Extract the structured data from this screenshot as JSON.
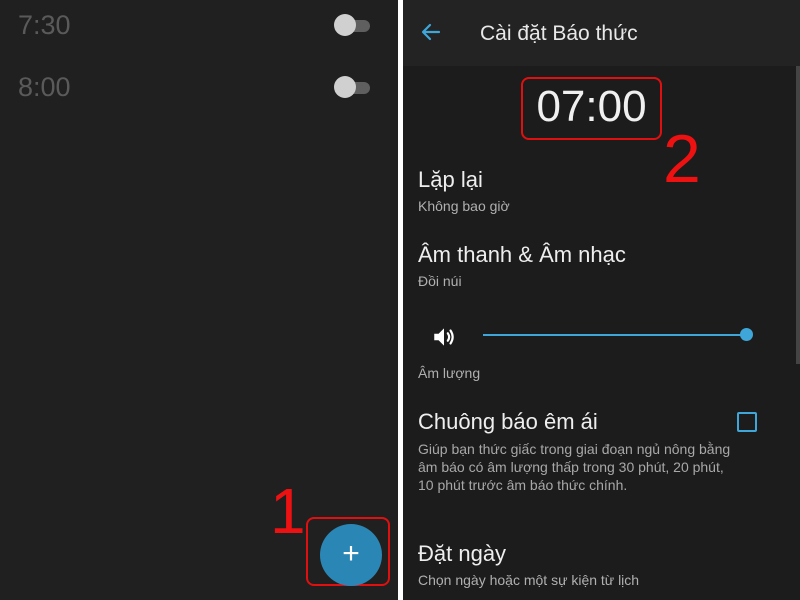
{
  "left_panel": {
    "alarms": [
      {
        "time": "7:30",
        "enabled": false
      },
      {
        "time": "8:00",
        "enabled": false
      }
    ],
    "add_button": {
      "label": "+"
    },
    "marker_label": "1"
  },
  "right_panel": {
    "header": {
      "title": "Cài đặt Báo thức",
      "back_icon": "arrow-left-icon"
    },
    "alarm_time": "07:00",
    "marker_label": "2",
    "repeat": {
      "title": "Lặp lại",
      "value": "Không bao giờ"
    },
    "sound": {
      "title": "Âm thanh & Âm nhạc",
      "value": "Đồi núi"
    },
    "volume": {
      "label": "Âm lượng",
      "level": 1.0,
      "icon": "volume-icon"
    },
    "gentle_alarm": {
      "title": "Chuông báo êm ái",
      "description": "Giúp bạn thức giấc trong giai đoạn ngủ nông bằng âm báo có âm lượng thấp trong 30 phút, 20 phút, 10 phút trước âm báo thức chính.",
      "checked": false
    },
    "set_date": {
      "title": "Đặt ngày",
      "value": "Chọn ngày hoặc một sự kiện từ lịch"
    }
  },
  "colors": {
    "accent": "#3ea6d8",
    "fab": "#2a86b4",
    "highlight": "#e01010"
  }
}
